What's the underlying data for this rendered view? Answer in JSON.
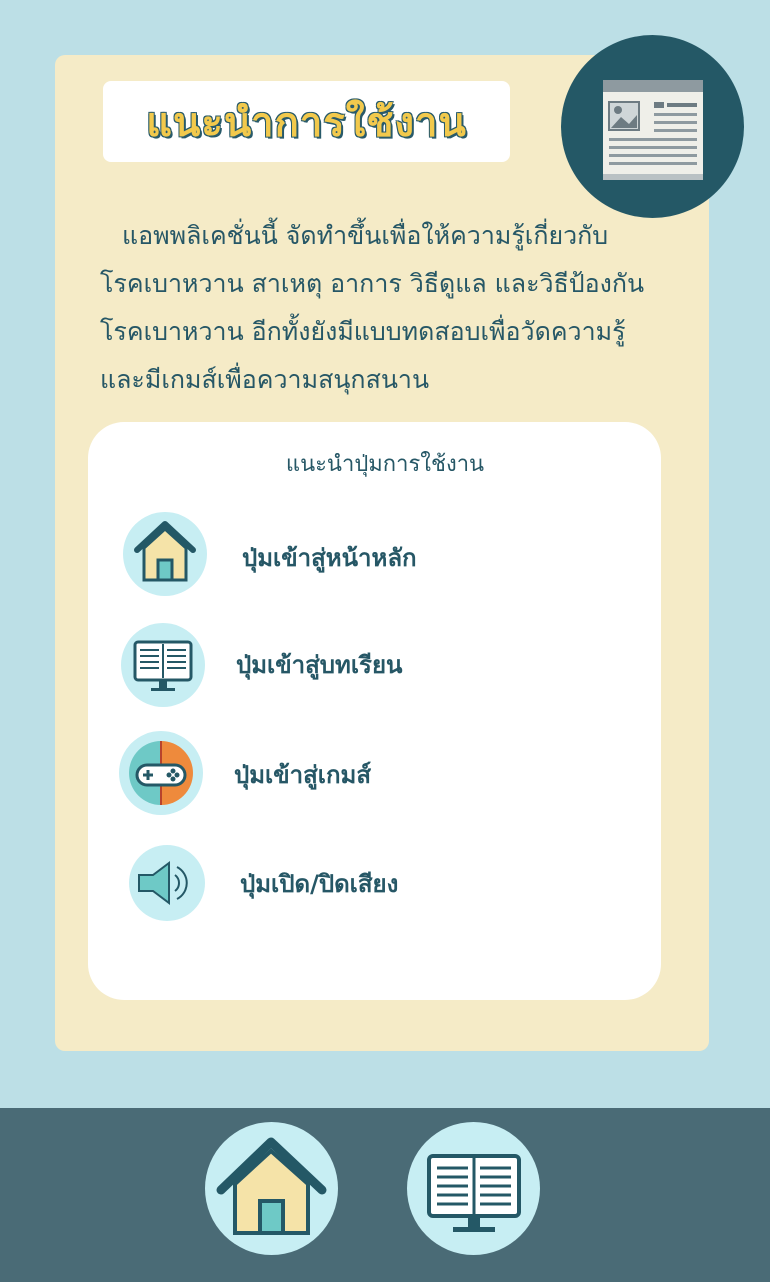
{
  "header": {
    "title": "แนะนำการใช้งาน",
    "icon": "newspaper-icon"
  },
  "intro_lines": [
    "แอพพลิเคชั่นนี้ จัดทำขึ้นเพื่อให้ความรู้เกี่ยวกับ",
    "โรคเบาหวาน สาเหตุ อาการ วิธีดูแล และวิธีป้องกัน",
    "โรคเบาหวาน อีกทั้งยังมีแบบทดสอบเพื่อวัดความรู้",
    "และมีเกมส์เพื่อความสนุกสนาน"
  ],
  "guide": {
    "title": "แนะนำปุ่มการใช้งาน",
    "items": [
      {
        "icon": "home-icon",
        "label": "ปุ่มเข้าสู่หน้าหลัก"
      },
      {
        "icon": "book-monitor-icon",
        "label": "ปุ่มเข้าสู่บทเรียน"
      },
      {
        "icon": "gamepad-icon",
        "label": "ปุ่มเข้าสู่เกมส์"
      },
      {
        "icon": "speaker-icon",
        "label": "ปุ่มเปิด/ปิดเสียง"
      }
    ]
  },
  "bottom_nav": [
    {
      "icon": "home-icon"
    },
    {
      "icon": "book-monitor-icon"
    }
  ],
  "colors": {
    "background": "#bcdfe6",
    "card": "#f5ebc7",
    "dark_teal": "#245866",
    "title_yellow": "#f2c94c",
    "icon_circle": "#c7eef3",
    "bottom_bar": "#4a6b76"
  }
}
